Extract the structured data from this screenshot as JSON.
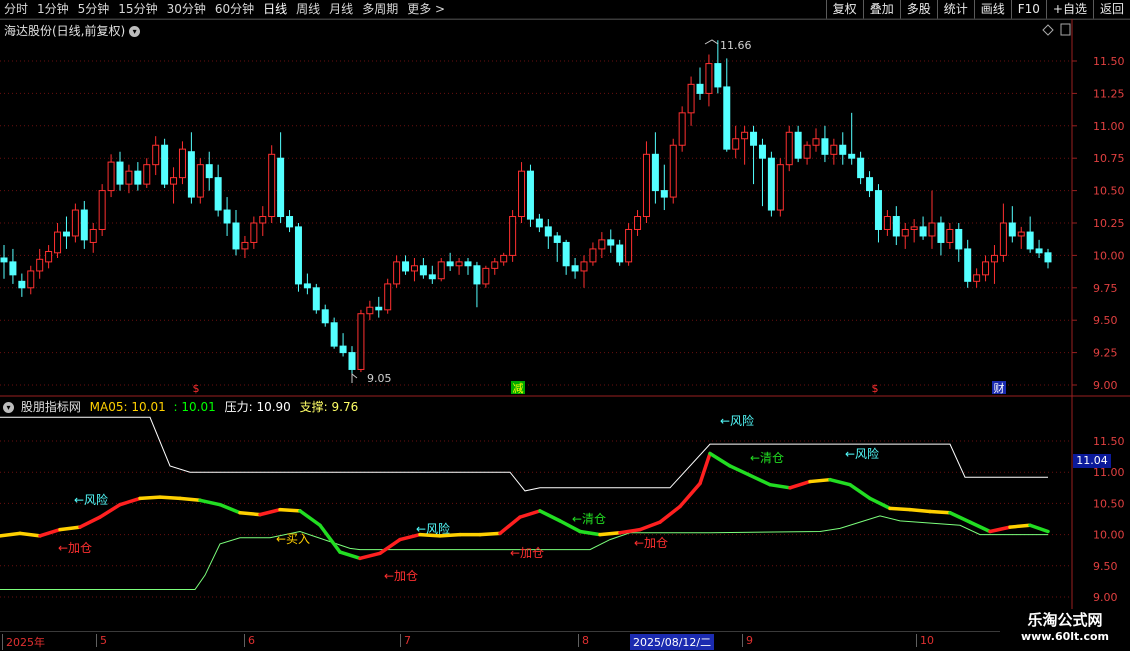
{
  "toolbar": {
    "periods": [
      "分时",
      "1分钟",
      "5分钟",
      "15分钟",
      "30分钟",
      "60分钟",
      "日线",
      "周线",
      "月线",
      "多周期",
      "更多 >"
    ],
    "active_period": "日线",
    "actions": [
      "复权",
      "叠加",
      "多股",
      "统计",
      "画线",
      "F10",
      "+自选",
      "返回"
    ]
  },
  "main_title": "海达股份(日线,前复权)",
  "indicator": {
    "name": "股朋指标网",
    "ma_label": "MA05: 10.01",
    "ma_value2": ": 10.01",
    "pressure_label": "压力: 10.90",
    "support_label": "支撑: 9.76"
  },
  "annotations": {
    "high_price": "11.66",
    "low_price": "9.05",
    "risk": "←风险",
    "add": "←加仓",
    "clear": "←清仓",
    "buy": "←买入"
  },
  "markers": {
    "s1": "$",
    "reduce": "减",
    "s2": "$",
    "cai": "财"
  },
  "price_axis": [
    "11.50",
    "11.25",
    "11.00",
    "10.75",
    "10.50",
    "10.25",
    "10.00",
    "9.75",
    "9.50",
    "9.25",
    "9.00"
  ],
  "ind_axis": [
    "11.50",
    "11.00",
    "10.50",
    "10.00",
    "9.50",
    "9.00"
  ],
  "current_price": "11.04",
  "date_axis": [
    "2025年",
    "5",
    "6",
    "7",
    "8",
    "2025/08/12/二",
    "9",
    "10"
  ],
  "watermark": {
    "line1": "乐淘公式网",
    "line2": "www.60lt.com"
  },
  "colors": {
    "up": "#ff3030",
    "down": "#54ffff",
    "grid": "#7a1010",
    "white_line": "#ffffff",
    "green_line": "#7cff7c"
  },
  "chart_data": {
    "type": "candlestick",
    "ylim": [
      9.0,
      11.75
    ],
    "candles": [
      [
        9.98,
        10.08,
        9.82,
        9.95
      ],
      [
        9.95,
        10.05,
        9.78,
        9.85
      ],
      [
        9.8,
        9.86,
        9.68,
        9.75
      ],
      [
        9.75,
        9.92,
        9.7,
        9.88
      ],
      [
        9.88,
        10.05,
        9.82,
        9.97
      ],
      [
        9.95,
        10.08,
        9.9,
        10.03
      ],
      [
        10.02,
        10.25,
        9.98,
        10.18
      ],
      [
        10.18,
        10.3,
        10.05,
        10.15
      ],
      [
        10.15,
        10.4,
        10.1,
        10.35
      ],
      [
        10.35,
        10.42,
        10.05,
        10.12
      ],
      [
        10.1,
        10.25,
        10.02,
        10.2
      ],
      [
        10.2,
        10.55,
        10.15,
        10.5
      ],
      [
        10.5,
        10.78,
        10.45,
        10.72
      ],
      [
        10.72,
        10.8,
        10.5,
        10.55
      ],
      [
        10.55,
        10.7,
        10.48,
        10.65
      ],
      [
        10.65,
        10.72,
        10.5,
        10.55
      ],
      [
        10.55,
        10.75,
        10.52,
        10.7
      ],
      [
        10.7,
        10.92,
        10.62,
        10.85
      ],
      [
        10.85,
        10.9,
        10.52,
        10.55
      ],
      [
        10.55,
        10.68,
        10.4,
        10.6
      ],
      [
        10.6,
        10.88,
        10.55,
        10.82
      ],
      [
        10.8,
        10.95,
        10.4,
        10.45
      ],
      [
        10.45,
        10.75,
        10.4,
        10.7
      ],
      [
        10.7,
        10.8,
        10.5,
        10.6
      ],
      [
        10.6,
        10.7,
        10.3,
        10.35
      ],
      [
        10.35,
        10.45,
        10.15,
        10.25
      ],
      [
        10.25,
        10.35,
        10.0,
        10.05
      ],
      [
        10.05,
        10.15,
        9.98,
        10.1
      ],
      [
        10.1,
        10.3,
        10.05,
        10.25
      ],
      [
        10.25,
        10.38,
        10.15,
        10.3
      ],
      [
        10.3,
        10.85,
        10.25,
        10.78
      ],
      [
        10.75,
        10.95,
        10.25,
        10.3
      ],
      [
        10.3,
        10.35,
        10.18,
        10.22
      ],
      [
        10.22,
        10.25,
        9.72,
        9.78
      ],
      [
        9.78,
        9.86,
        9.7,
        9.75
      ],
      [
        9.75,
        9.78,
        9.55,
        9.58
      ],
      [
        9.58,
        9.62,
        9.45,
        9.48
      ],
      [
        9.48,
        9.52,
        9.28,
        9.3
      ],
      [
        9.3,
        9.4,
        9.22,
        9.25
      ],
      [
        9.25,
        9.3,
        9.05,
        9.12
      ],
      [
        9.12,
        9.58,
        9.1,
        9.55
      ],
      [
        9.55,
        9.65,
        9.5,
        9.6
      ],
      [
        9.6,
        9.68,
        9.52,
        9.58
      ],
      [
        9.58,
        9.82,
        9.55,
        9.78
      ],
      [
        9.78,
        10.0,
        9.75,
        9.95
      ],
      [
        9.95,
        10.0,
        9.85,
        9.88
      ],
      [
        9.88,
        9.98,
        9.8,
        9.92
      ],
      [
        9.92,
        9.98,
        9.82,
        9.85
      ],
      [
        9.85,
        9.92,
        9.78,
        9.82
      ],
      [
        9.82,
        9.98,
        9.8,
        9.95
      ],
      [
        9.95,
        10.02,
        9.88,
        9.92
      ],
      [
        9.92,
        9.98,
        9.85,
        9.95
      ],
      [
        9.95,
        9.98,
        9.85,
        9.92
      ],
      [
        9.92,
        9.95,
        9.6,
        9.78
      ],
      [
        9.78,
        9.92,
        9.75,
        9.9
      ],
      [
        9.9,
        9.98,
        9.85,
        9.95
      ],
      [
        9.95,
        10.02,
        9.92,
        10.0
      ],
      [
        10.0,
        10.35,
        9.95,
        10.3
      ],
      [
        10.3,
        10.72,
        10.25,
        10.65
      ],
      [
        10.65,
        10.7,
        10.22,
        10.28
      ],
      [
        10.28,
        10.32,
        10.18,
        10.22
      ],
      [
        10.22,
        10.28,
        10.05,
        10.15
      ],
      [
        10.15,
        10.18,
        9.95,
        10.1
      ],
      [
        10.1,
        10.12,
        9.85,
        9.92
      ],
      [
        9.92,
        9.98,
        9.82,
        9.88
      ],
      [
        9.88,
        10.0,
        9.75,
        9.95
      ],
      [
        9.95,
        10.1,
        9.92,
        10.05
      ],
      [
        10.05,
        10.18,
        9.98,
        10.12
      ],
      [
        10.12,
        10.2,
        10.02,
        10.08
      ],
      [
        10.08,
        10.12,
        9.92,
        9.95
      ],
      [
        9.95,
        10.25,
        9.92,
        10.2
      ],
      [
        10.2,
        10.35,
        10.15,
        10.3
      ],
      [
        10.3,
        10.88,
        10.25,
        10.78
      ],
      [
        10.78,
        10.95,
        10.4,
        10.5
      ],
      [
        10.5,
        10.7,
        10.35,
        10.45
      ],
      [
        10.45,
        10.9,
        10.4,
        10.85
      ],
      [
        10.85,
        11.15,
        10.8,
        11.1
      ],
      [
        11.1,
        11.38,
        11.0,
        11.32
      ],
      [
        11.32,
        11.45,
        11.2,
        11.25
      ],
      [
        11.25,
        11.55,
        11.15,
        11.48
      ],
      [
        11.48,
        11.66,
        11.25,
        11.3
      ],
      [
        11.3,
        11.52,
        10.8,
        10.82
      ],
      [
        10.82,
        11.0,
        10.75,
        10.9
      ],
      [
        10.9,
        11.0,
        10.7,
        10.95
      ],
      [
        10.95,
        11.0,
        10.55,
        10.85
      ],
      [
        10.85,
        10.9,
        10.38,
        10.75
      ],
      [
        10.75,
        10.8,
        10.3,
        10.35
      ],
      [
        10.35,
        10.75,
        10.3,
        10.7
      ],
      [
        10.7,
        11.0,
        10.65,
        10.95
      ],
      [
        10.95,
        11.0,
        10.72,
        10.75
      ],
      [
        10.75,
        10.88,
        10.7,
        10.85
      ],
      [
        10.85,
        10.98,
        10.8,
        10.9
      ],
      [
        10.9,
        11.0,
        10.72,
        10.78
      ],
      [
        10.78,
        10.9,
        10.7,
        10.85
      ],
      [
        10.85,
        10.95,
        10.7,
        10.78
      ],
      [
        10.78,
        11.1,
        10.7,
        10.75
      ],
      [
        10.75,
        10.8,
        10.55,
        10.6
      ],
      [
        10.6,
        10.65,
        10.45,
        10.5
      ],
      [
        10.5,
        10.55,
        10.1,
        10.2
      ],
      [
        10.2,
        10.35,
        10.15,
        10.3
      ],
      [
        10.3,
        10.38,
        10.08,
        10.15
      ],
      [
        10.15,
        10.25,
        10.05,
        10.2
      ],
      [
        10.2,
        10.28,
        10.1,
        10.22
      ],
      [
        10.22,
        10.3,
        10.12,
        10.15
      ],
      [
        10.15,
        10.5,
        10.05,
        10.25
      ],
      [
        10.25,
        10.3,
        10.0,
        10.1
      ],
      [
        10.1,
        10.25,
        10.05,
        10.2
      ],
      [
        10.2,
        10.25,
        9.95,
        10.05
      ],
      [
        10.05,
        10.12,
        9.75,
        9.8
      ],
      [
        9.8,
        9.9,
        9.75,
        9.85
      ],
      [
        9.85,
        10.0,
        9.8,
        9.95
      ],
      [
        9.95,
        10.08,
        9.78,
        10.0
      ],
      [
        10.0,
        10.4,
        9.95,
        10.25
      ],
      [
        10.25,
        10.38,
        10.1,
        10.15
      ],
      [
        10.15,
        10.22,
        10.05,
        10.18
      ],
      [
        10.18,
        10.3,
        10.02,
        10.05
      ],
      [
        10.05,
        10.12,
        9.98,
        10.02
      ],
      [
        10.02,
        10.05,
        9.9,
        9.95
      ]
    ],
    "indicator_ylim": [
      9.0,
      12.0
    ],
    "pressure_line": [
      [
        0,
        11.88
      ],
      [
        150,
        11.88
      ],
      [
        170,
        11.1
      ],
      [
        190,
        11.0
      ],
      [
        280,
        11.0
      ],
      [
        510,
        11.0
      ],
      [
        525,
        10.7
      ],
      [
        540,
        10.75
      ],
      [
        670,
        10.75
      ],
      [
        710,
        11.45
      ],
      [
        950,
        11.45
      ],
      [
        965,
        10.92
      ],
      [
        1048,
        10.92
      ]
    ],
    "support_line": [
      [
        0,
        9.12
      ],
      [
        195,
        9.12
      ],
      [
        205,
        9.35
      ],
      [
        220,
        9.85
      ],
      [
        240,
        9.95
      ],
      [
        270,
        9.95
      ],
      [
        300,
        10.05
      ],
      [
        350,
        9.78
      ],
      [
        360,
        9.76
      ],
      [
        590,
        9.76
      ],
      [
        610,
        9.92
      ],
      [
        630,
        10.03
      ],
      [
        710,
        10.03
      ],
      [
        820,
        10.05
      ],
      [
        840,
        10.1
      ],
      [
        860,
        10.2
      ],
      [
        880,
        10.3
      ],
      [
        900,
        10.22
      ],
      [
        960,
        10.15
      ],
      [
        980,
        10.0
      ],
      [
        1048,
        10.0
      ]
    ],
    "ma_line": [
      [
        0,
        9.98
      ],
      [
        20,
        10.02
      ],
      [
        40,
        9.98
      ],
      [
        60,
        10.08
      ],
      [
        80,
        10.12
      ],
      [
        100,
        10.28
      ],
      [
        120,
        10.48
      ],
      [
        140,
        10.58
      ],
      [
        160,
        10.6
      ],
      [
        180,
        10.58
      ],
      [
        200,
        10.55
      ],
      [
        220,
        10.48
      ],
      [
        240,
        10.35
      ],
      [
        260,
        10.32
      ],
      [
        280,
        10.4
      ],
      [
        300,
        10.38
      ],
      [
        320,
        10.15
      ],
      [
        340,
        9.72
      ],
      [
        360,
        9.62
      ],
      [
        380,
        9.7
      ],
      [
        400,
        9.92
      ],
      [
        420,
        10.0
      ],
      [
        440,
        9.98
      ],
      [
        460,
        10.0
      ],
      [
        480,
        10.0
      ],
      [
        500,
        10.02
      ],
      [
        520,
        10.28
      ],
      [
        540,
        10.38
      ],
      [
        560,
        10.22
      ],
      [
        580,
        10.05
      ],
      [
        600,
        10.0
      ],
      [
        620,
        10.03
      ],
      [
        640,
        10.08
      ],
      [
        660,
        10.2
      ],
      [
        680,
        10.45
      ],
      [
        700,
        10.82
      ],
      [
        710,
        11.3
      ],
      [
        730,
        11.1
      ],
      [
        750,
        10.95
      ],
      [
        770,
        10.8
      ],
      [
        790,
        10.75
      ],
      [
        810,
        10.85
      ],
      [
        830,
        10.88
      ],
      [
        850,
        10.8
      ],
      [
        870,
        10.58
      ],
      [
        890,
        10.42
      ],
      [
        910,
        10.4
      ],
      [
        930,
        10.37
      ],
      [
        950,
        10.35
      ],
      [
        970,
        10.2
      ],
      [
        990,
        10.05
      ],
      [
        1010,
        10.12
      ],
      [
        1030,
        10.15
      ],
      [
        1048,
        10.05
      ]
    ]
  }
}
